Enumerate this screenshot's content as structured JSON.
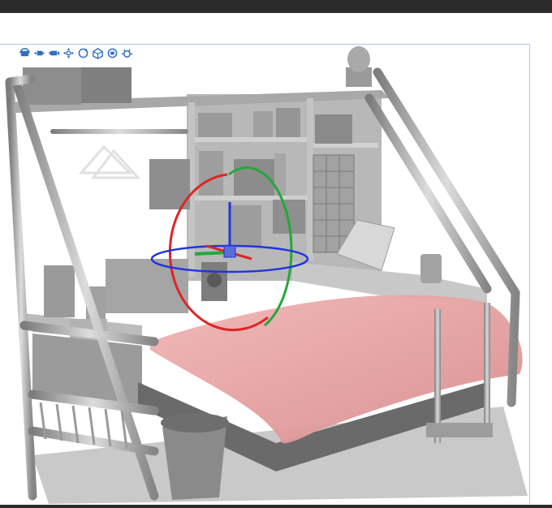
{
  "app": {
    "name": ""
  },
  "toolbar": {
    "tools": [
      {
        "name": "camera-rotate-icon"
      },
      {
        "name": "camera-pan-icon"
      },
      {
        "name": "camera-dolly-icon"
      },
      {
        "name": "move-object-icon"
      },
      {
        "name": "rotate-object-icon"
      },
      {
        "name": "object-pose-icon"
      },
      {
        "name": "camera-reset-icon"
      },
      {
        "name": "object-settings-icon"
      }
    ],
    "icon_color": "#2f6fbf"
  },
  "scene": {
    "description_colors": {
      "model": "#bdbdbd",
      "model_dark": "#8a8a8a",
      "blanket": "#e8a3a3",
      "gizmo_x": "#e02424",
      "gizmo_y": "#22a83a",
      "gizmo_z": "#2034e0"
    }
  }
}
